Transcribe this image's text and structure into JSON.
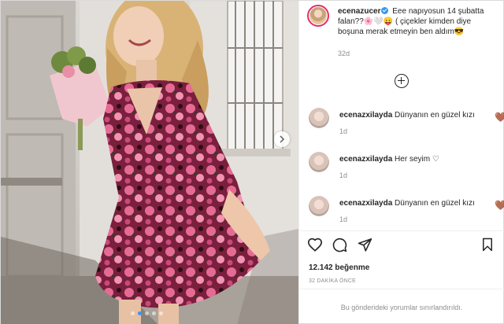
{
  "post": {
    "username": "ecenazucer",
    "caption_line1": "Eee napıyosun 14 şubatta",
    "caption_line2": "falan??🌸🤍😛 ( çiçekler kimden diye",
    "caption_line3": "boşuna merak etmeyin ben aldım😎",
    "time": "32d",
    "likes": "12.142 beğenme",
    "posted_ago": "32 DAKİKA ÖNCE",
    "comments_limited": "Bu gönderideki yorumlar sınırlandırıldı."
  },
  "comments": [
    {
      "username": "ecenazxilayda",
      "text": "Dünyanın en güzel kızı",
      "time": "1d",
      "heart": "🤎"
    },
    {
      "username": "ecenazxilayda",
      "text": "Her seyim",
      "time": "1d",
      "heart": "♡"
    },
    {
      "username": "ecenazxilayda",
      "text": "Dünyanın en güzel kızı",
      "time": "1d",
      "heart": "🤎"
    }
  ],
  "icons": {
    "like": "heart-outline-icon",
    "comment": "comment-bubble-icon",
    "share": "paper-plane-icon",
    "save": "bookmark-icon",
    "more_comments": "plus-circle-icon",
    "next": "chevron-right-icon"
  },
  "colors": {
    "verified": "#3897f0",
    "text": "#262626",
    "muted": "#8e8e8e",
    "story_ring": "#e1306c"
  },
  "carousel": {
    "slides": 5,
    "active_slide": 2
  }
}
